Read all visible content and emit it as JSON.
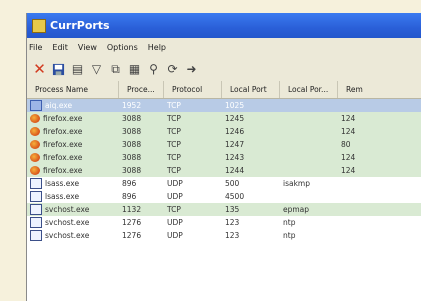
{
  "window": {
    "title": "CurrPorts"
  },
  "menu": [
    "File",
    "Edit",
    "View",
    "Options",
    "Help"
  ],
  "toolbar_icons": [
    "close-icon",
    "save-icon",
    "properties-icon",
    "filter-icon",
    "copy-icon",
    "html-report-icon",
    "find-icon",
    "refresh-icon",
    "exit-icon"
  ],
  "columns": [
    "Process Name",
    "Proce...",
    "Protocol",
    "Local Port",
    "Local Por...",
    "Rem"
  ],
  "rows": [
    {
      "name": "aiq.exe",
      "pid": "1952",
      "protocol": "TCP",
      "local_port": "1025",
      "local_port_name": "",
      "remote": "",
      "icon": "highlight",
      "selected": true
    },
    {
      "name": "firefox.exe",
      "pid": "3088",
      "protocol": "TCP",
      "local_port": "1245",
      "local_port_name": "",
      "remote": "124",
      "icon": "firefox"
    },
    {
      "name": "firefox.exe",
      "pid": "3088",
      "protocol": "TCP",
      "local_port": "1246",
      "local_port_name": "",
      "remote": "124",
      "icon": "firefox"
    },
    {
      "name": "firefox.exe",
      "pid": "3088",
      "protocol": "TCP",
      "local_port": "1247",
      "local_port_name": "",
      "remote": "80",
      "icon": "firefox"
    },
    {
      "name": "firefox.exe",
      "pid": "3088",
      "protocol": "TCP",
      "local_port": "1243",
      "local_port_name": "",
      "remote": "124",
      "icon": "firefox"
    },
    {
      "name": "firefox.exe",
      "pid": "3088",
      "protocol": "TCP",
      "local_port": "1244",
      "local_port_name": "",
      "remote": "124",
      "icon": "firefox"
    },
    {
      "name": "lsass.exe",
      "pid": "896",
      "protocol": "UDP",
      "local_port": "500",
      "local_port_name": "isakmp",
      "remote": "",
      "icon": "window"
    },
    {
      "name": "lsass.exe",
      "pid": "896",
      "protocol": "UDP",
      "local_port": "4500",
      "local_port_name": "",
      "remote": "",
      "icon": "window"
    },
    {
      "name": "svchost.exe",
      "pid": "1132",
      "protocol": "TCP",
      "local_port": "135",
      "local_port_name": "epmap",
      "remote": "",
      "icon": "window"
    },
    {
      "name": "svchost.exe",
      "pid": "1276",
      "protocol": "UDP",
      "local_port": "123",
      "local_port_name": "ntp",
      "remote": "",
      "icon": "window"
    },
    {
      "name": "svchost.exe",
      "pid": "1276",
      "protocol": "UDP",
      "local_port": "123",
      "local_port_name": "ntp",
      "remote": "",
      "icon": "window"
    }
  ]
}
